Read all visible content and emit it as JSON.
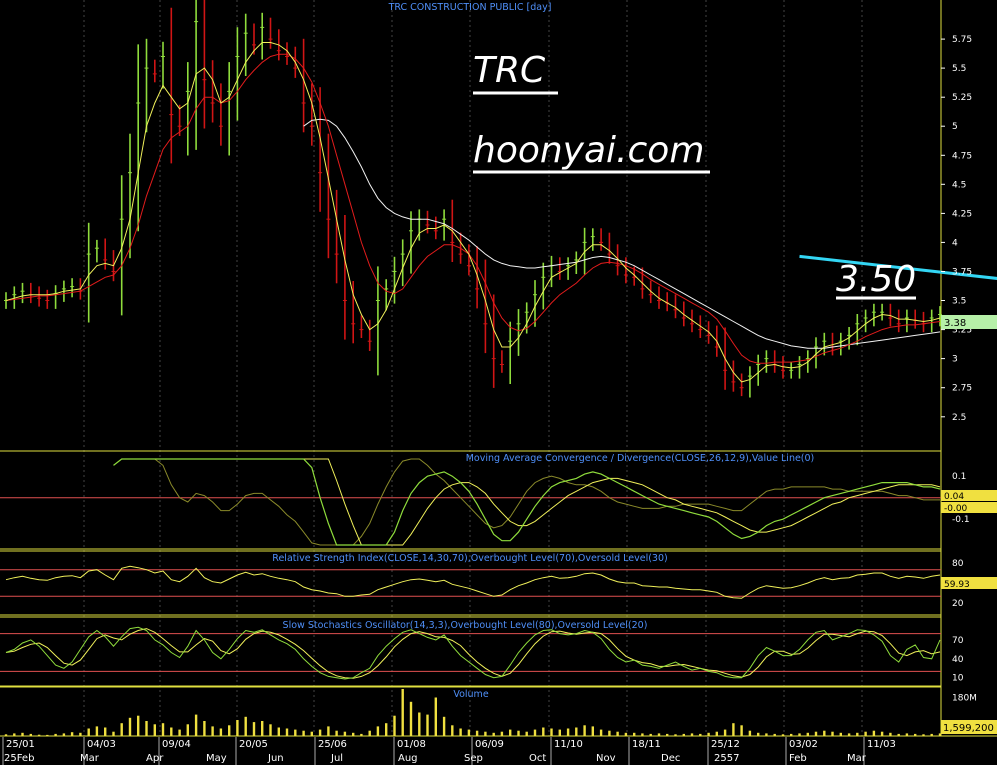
{
  "chart_data": {
    "type": "line",
    "title": "TRC CONSTRUCTION PUBLIC [day]",
    "annotations": {
      "ticker": "TRC",
      "website": "hoonyai.com",
      "price_target": "3.50"
    },
    "colors": {
      "background": "#000000",
      "candle_up": "#8fdc3c",
      "candle_down": "#d01515",
      "ma_fast": "#f0f05a",
      "ma_mid": "#e21c1c",
      "ma_slow": "#f2f2f2",
      "trendline": "#33d6f4",
      "panel_border": "#e0e040",
      "level_line": "#e05050",
      "header_text": "#4f8ff7",
      "volume": "#f0e040",
      "last_label_price": "#b6f0a8",
      "last_label_other": "#f0e040"
    },
    "price_panel": {
      "ylim": [
        2.3,
        6.0
      ],
      "y_ticks": [
        "5.75",
        "5.5",
        "5.25",
        "5",
        "4.75",
        "4.5",
        "4.25",
        "4",
        "3.75",
        "3.5",
        "3.25",
        "3",
        "2.75",
        "2.5"
      ],
      "last_value": "3.38",
      "trendline": {
        "from": [
          96,
          3.88
        ],
        "to": [
          159,
          3.38
        ]
      },
      "close": [
        3.5,
        3.55,
        3.58,
        3.55,
        3.52,
        3.5,
        3.56,
        3.6,
        3.62,
        3.58,
        3.9,
        3.95,
        3.85,
        3.75,
        4.2,
        4.6,
        5.2,
        5.5,
        5.45,
        5.6,
        5.1,
        5.0,
        5.3,
        5.9,
        5.4,
        5.2,
        5.0,
        5.3,
        5.6,
        5.8,
        5.7,
        5.85,
        5.75,
        5.65,
        5.6,
        5.5,
        5.2,
        5.0,
        4.6,
        4.2,
        3.9,
        3.5,
        3.3,
        3.25,
        3.15,
        3.5,
        3.6,
        3.75,
        3.9,
        4.1,
        4.2,
        4.15,
        4.1,
        4.2,
        4.0,
        3.9,
        3.8,
        3.6,
        3.3,
        3.0,
        2.95,
        3.15,
        3.3,
        3.4,
        3.55,
        3.7,
        3.8,
        3.75,
        3.8,
        3.85,
        4.0,
        4.05,
        4.0,
        3.9,
        3.8,
        3.72,
        3.7,
        3.6,
        3.55,
        3.5,
        3.48,
        3.42,
        3.35,
        3.3,
        3.25,
        3.2,
        3.1,
        2.9,
        2.8,
        2.75,
        2.85,
        2.95,
        3.0,
        2.95,
        2.9,
        2.9,
        2.95,
        3.0,
        3.1,
        3.15,
        3.1,
        3.15,
        3.2,
        3.3,
        3.35,
        3.4,
        3.4,
        3.35,
        3.3,
        3.35,
        3.33,
        3.3,
        3.35,
        3.38
      ],
      "ma_fast": [
        3.5,
        3.52,
        3.54,
        3.55,
        3.55,
        3.55,
        3.56,
        3.58,
        3.59,
        3.6,
        3.72,
        3.8,
        3.82,
        3.8,
        3.95,
        4.2,
        4.6,
        5.0,
        5.2,
        5.35,
        5.25,
        5.15,
        5.2,
        5.45,
        5.5,
        5.4,
        5.2,
        5.25,
        5.4,
        5.55,
        5.65,
        5.72,
        5.72,
        5.7,
        5.65,
        5.55,
        5.4,
        5.2,
        4.9,
        4.55,
        4.2,
        3.85,
        3.55,
        3.38,
        3.25,
        3.3,
        3.42,
        3.6,
        3.78,
        3.95,
        4.08,
        4.12,
        4.12,
        4.15,
        4.1,
        4.0,
        3.9,
        3.72,
        3.5,
        3.25,
        3.1,
        3.1,
        3.18,
        3.3,
        3.45,
        3.58,
        3.7,
        3.74,
        3.78,
        3.82,
        3.92,
        3.98,
        3.98,
        3.93,
        3.86,
        3.78,
        3.72,
        3.65,
        3.58,
        3.52,
        3.48,
        3.44,
        3.38,
        3.33,
        3.28,
        3.23,
        3.15,
        3.0,
        2.88,
        2.8,
        2.82,
        2.88,
        2.94,
        2.95,
        2.93,
        2.92,
        2.93,
        2.97,
        3.04,
        3.1,
        3.12,
        3.14,
        3.18,
        3.24,
        3.3,
        3.35,
        3.38,
        3.37,
        3.34,
        3.34,
        3.33,
        3.32,
        3.33,
        3.35
      ],
      "ma_mid": [
        3.5,
        3.51,
        3.52,
        3.53,
        3.54,
        3.54,
        3.55,
        3.56,
        3.57,
        3.58,
        3.62,
        3.66,
        3.7,
        3.72,
        3.8,
        3.95,
        4.15,
        4.4,
        4.6,
        4.8,
        4.9,
        4.95,
        5.0,
        5.15,
        5.25,
        5.25,
        5.2,
        5.22,
        5.3,
        5.4,
        5.48,
        5.55,
        5.6,
        5.62,
        5.62,
        5.58,
        5.5,
        5.38,
        5.2,
        5.0,
        4.75,
        4.5,
        4.25,
        4.0,
        3.8,
        3.65,
        3.58,
        3.56,
        3.6,
        3.7,
        3.8,
        3.88,
        3.93,
        3.98,
        3.98,
        3.95,
        3.9,
        3.8,
        3.65,
        3.48,
        3.35,
        3.27,
        3.24,
        3.26,
        3.32,
        3.4,
        3.48,
        3.55,
        3.6,
        3.65,
        3.72,
        3.78,
        3.82,
        3.83,
        3.82,
        3.8,
        3.77,
        3.73,
        3.68,
        3.64,
        3.6,
        3.56,
        3.52,
        3.48,
        3.44,
        3.4,
        3.34,
        3.24,
        3.13,
        3.03,
        2.98,
        2.96,
        2.96,
        2.97,
        2.97,
        2.97,
        2.98,
        2.99,
        3.02,
        3.05,
        3.07,
        3.09,
        3.12,
        3.15,
        3.19,
        3.22,
        3.25,
        3.27,
        3.28,
        3.29,
        3.29,
        3.3,
        3.31,
        3.32
      ],
      "ma_slow": [
        null,
        null,
        null,
        null,
        null,
        null,
        null,
        null,
        null,
        null,
        null,
        null,
        null,
        null,
        null,
        null,
        null,
        null,
        null,
        null,
        null,
        null,
        null,
        null,
        null,
        null,
        null,
        null,
        null,
        null,
        null,
        null,
        null,
        null,
        null,
        null,
        5.0,
        5.05,
        5.06,
        5.05,
        5.0,
        4.9,
        4.78,
        4.65,
        4.5,
        4.38,
        4.3,
        4.25,
        4.22,
        4.2,
        4.2,
        4.2,
        4.18,
        4.16,
        4.12,
        4.07,
        4.02,
        3.96,
        3.9,
        3.85,
        3.82,
        3.8,
        3.79,
        3.78,
        3.78,
        3.79,
        3.8,
        3.81,
        3.82,
        3.83,
        3.85,
        3.87,
        3.88,
        3.87,
        3.85,
        3.83,
        3.8,
        3.76,
        3.72,
        3.68,
        3.64,
        3.6,
        3.56,
        3.52,
        3.48,
        3.44,
        3.4,
        3.36,
        3.32,
        3.28,
        3.24,
        3.2,
        3.17,
        3.15,
        3.13,
        3.11,
        3.1,
        3.09,
        3.09,
        3.09,
        3.1,
        3.11,
        3.12,
        3.13,
        3.14,
        3.15,
        3.16,
        3.17,
        3.18,
        3.19,
        3.2,
        3.21,
        3.22,
        3.23
      ]
    },
    "macd_panel": {
      "label": "Moving Average Convergence / Divergence(CLOSE,26,12,9),Value Line(0)",
      "ylim": [
        -0.22,
        0.18
      ],
      "y_ticks": [
        "0.1",
        "-0.00",
        "-0.1"
      ],
      "zero_line": 0,
      "last_values": [
        "0.04",
        "-0.00"
      ],
      "macd": [
        null,
        null,
        null,
        null,
        null,
        null,
        null,
        null,
        null,
        null,
        null,
        null,
        null,
        0.15,
        0.24,
        0.36,
        0.5,
        0.62,
        0.66,
        0.68,
        0.63,
        0.58,
        0.56,
        0.6,
        0.6,
        0.56,
        0.5,
        0.48,
        0.5,
        0.54,
        0.56,
        0.56,
        0.53,
        0.48,
        0.42,
        0.35,
        0.25,
        0.14,
        0.0,
        -0.12,
        -0.22,
        -0.32,
        -0.38,
        -0.4,
        -0.4,
        -0.34,
        -0.26,
        -0.16,
        -0.06,
        0.02,
        0.07,
        0.1,
        0.11,
        0.12,
        0.1,
        0.07,
        0.03,
        -0.03,
        -0.1,
        -0.17,
        -0.2,
        -0.2,
        -0.16,
        -0.1,
        -0.04,
        0.01,
        0.05,
        0.07,
        0.08,
        0.09,
        0.11,
        0.12,
        0.11,
        0.09,
        0.07,
        0.05,
        0.03,
        0.01,
        -0.01,
        -0.03,
        -0.04,
        -0.05,
        -0.06,
        -0.07,
        -0.08,
        -0.09,
        -0.11,
        -0.14,
        -0.17,
        -0.19,
        -0.18,
        -0.16,
        -0.13,
        -0.11,
        -0.1,
        -0.08,
        -0.06,
        -0.04,
        -0.02,
        0.0,
        0.01,
        0.02,
        0.03,
        0.04,
        0.05,
        0.06,
        0.07,
        0.07,
        0.07,
        0.07,
        0.06,
        0.05,
        0.05,
        0.04
      ],
      "signal": [
        null,
        null,
        null,
        null,
        null,
        null,
        null,
        null,
        null,
        null,
        null,
        null,
        null,
        null,
        null,
        null,
        0.28,
        0.38,
        0.46,
        0.53,
        0.57,
        0.58,
        0.58,
        0.58,
        0.59,
        0.58,
        0.56,
        0.54,
        0.53,
        0.53,
        0.54,
        0.54,
        0.54,
        0.52,
        0.5,
        0.46,
        0.41,
        0.35,
        0.27,
        0.18,
        0.08,
        -0.03,
        -0.13,
        -0.22,
        -0.28,
        -0.31,
        -0.31,
        -0.28,
        -0.23,
        -0.17,
        -0.11,
        -0.05,
        0.0,
        0.04,
        0.06,
        0.07,
        0.07,
        0.05,
        0.02,
        -0.03,
        -0.07,
        -0.11,
        -0.13,
        -0.13,
        -0.11,
        -0.08,
        -0.05,
        -0.02,
        0.01,
        0.03,
        0.05,
        0.07,
        0.08,
        0.09,
        0.09,
        0.08,
        0.07,
        0.06,
        0.04,
        0.02,
        0.0,
        -0.01,
        -0.03,
        -0.04,
        -0.05,
        -0.06,
        -0.07,
        -0.09,
        -0.11,
        -0.13,
        -0.15,
        -0.16,
        -0.16,
        -0.15,
        -0.14,
        -0.13,
        -0.11,
        -0.09,
        -0.07,
        -0.05,
        -0.03,
        -0.02,
        0.0,
        0.01,
        0.02,
        0.03,
        0.04,
        0.05,
        0.06,
        0.06,
        0.06,
        0.06,
        0.06,
        0.05
      ],
      "histogram": [
        null,
        null,
        null,
        null,
        null,
        null,
        null,
        null,
        null,
        null,
        null,
        null,
        null,
        null,
        null,
        null,
        0.22,
        0.24,
        0.2,
        0.15,
        0.06,
        0.0,
        -0.02,
        0.02,
        0.01,
        -0.02,
        -0.06,
        -0.06,
        -0.03,
        0.01,
        0.02,
        0.02,
        -0.01,
        -0.04,
        -0.08,
        -0.11,
        -0.16,
        -0.21,
        -0.27,
        -0.3,
        -0.3,
        -0.29,
        -0.25,
        -0.18,
        -0.12,
        -0.03,
        0.05,
        0.12,
        0.17,
        0.19,
        0.18,
        0.15,
        0.11,
        0.08,
        0.04,
        0.0,
        -0.04,
        -0.08,
        -0.12,
        -0.14,
        -0.13,
        -0.09,
        -0.03,
        0.03,
        0.07,
        0.09,
        0.1,
        0.09,
        0.07,
        0.06,
        0.06,
        0.05,
        0.03,
        0.0,
        -0.02,
        -0.03,
        -0.04,
        -0.05,
        -0.05,
        -0.05,
        -0.04,
        -0.04,
        -0.03,
        -0.03,
        -0.03,
        -0.03,
        -0.04,
        -0.05,
        -0.06,
        -0.06,
        -0.03,
        0.0,
        0.03,
        0.04,
        0.04,
        0.05,
        0.05,
        0.05,
        0.05,
        0.05,
        0.04,
        0.04,
        0.03,
        0.03,
        0.03,
        0.03,
        0.03,
        0.02,
        0.01,
        0.01,
        0.0,
        -0.01,
        -0.01,
        -0.01
      ]
    },
    "rsi_panel": {
      "label": "Relative Strength Index(CLOSE,14,30,70),Overbought Level(70),Oversold Level(30)",
      "ylim": [
        5,
        95
      ],
      "y_ticks": [
        "80",
        "20"
      ],
      "overbought": 70,
      "oversold": 30,
      "last_value": "59.93",
      "rsi": [
        55,
        58,
        60,
        57,
        55,
        54,
        58,
        60,
        61,
        58,
        68,
        70,
        62,
        55,
        72,
        75,
        73,
        70,
        65,
        68,
        55,
        52,
        60,
        72,
        58,
        52,
        50,
        56,
        62,
        66,
        62,
        64,
        60,
        57,
        55,
        52,
        44,
        40,
        38,
        35,
        34,
        30,
        30,
        32,
        33,
        40,
        44,
        48,
        52,
        55,
        56,
        54,
        52,
        54,
        48,
        45,
        42,
        38,
        34,
        30,
        32,
        40,
        46,
        50,
        55,
        58,
        60,
        57,
        58,
        60,
        64,
        65,
        62,
        56,
        52,
        50,
        50,
        46,
        45,
        44,
        44,
        42,
        41,
        40,
        40,
        38,
        36,
        30,
        28,
        27,
        35,
        42,
        46,
        44,
        42,
        43,
        46,
        50,
        55,
        58,
        55,
        57,
        58,
        62,
        63,
        65,
        65,
        60,
        57,
        60,
        59,
        57,
        60,
        62
      ]
    },
    "stoch_panel": {
      "label": "Slow Stochastics Oscillator(14,3,3),Overbought Level(80),Oversold Level(20)",
      "ylim": [
        0,
        100
      ],
      "y_ticks": [
        "70",
        "40",
        "10"
      ],
      "overbought": 80,
      "oversold": 20,
      "k": [
        50,
        55,
        65,
        70,
        60,
        45,
        30,
        25,
        35,
        55,
        75,
        85,
        75,
        60,
        75,
        88,
        90,
        85,
        70,
        62,
        50,
        42,
        60,
        85,
        70,
        50,
        40,
        55,
        72,
        85,
        82,
        86,
        78,
        70,
        64,
        55,
        40,
        28,
        18,
        12,
        10,
        8,
        10,
        18,
        25,
        45,
        60,
        72,
        82,
        86,
        80,
        74,
        70,
        78,
        60,
        45,
        35,
        25,
        15,
        10,
        12,
        30,
        50,
        65,
        78,
        85,
        86,
        80,
        78,
        80,
        85,
        82,
        72,
        55,
        42,
        35,
        38,
        30,
        28,
        25,
        30,
        35,
        28,
        22,
        25,
        20,
        18,
        12,
        10,
        10,
        25,
        45,
        58,
        52,
        45,
        45,
        55,
        70,
        82,
        85,
        70,
        75,
        80,
        86,
        85,
        78,
        68,
        45,
        35,
        55,
        62,
        42,
        40,
        70
      ],
      "d": [
        50,
        52,
        58,
        63,
        65,
        58,
        45,
        33,
        30,
        38,
        55,
        72,
        78,
        73,
        70,
        79,
        85,
        88,
        82,
        72,
        61,
        51,
        51,
        62,
        72,
        68,
        53,
        48,
        56,
        71,
        80,
        84,
        82,
        78,
        71,
        63,
        53,
        41,
        29,
        19,
        13,
        10,
        9,
        12,
        18,
        29,
        43,
        59,
        71,
        80,
        83,
        80,
        75,
        74,
        69,
        61,
        47,
        35,
        25,
        17,
        12,
        17,
        31,
        48,
        64,
        76,
        83,
        84,
        81,
        79,
        81,
        82,
        80,
        70,
        56,
        44,
        38,
        34,
        32,
        28,
        28,
        30,
        31,
        28,
        25,
        22,
        21,
        17,
        13,
        11,
        15,
        27,
        43,
        52,
        52,
        47,
        48,
        57,
        69,
        79,
        79,
        77,
        75,
        80,
        84,
        83,
        77,
        64,
        49,
        45,
        51,
        53,
        48,
        51
      ]
    },
    "volume_panel": {
      "label": "Volume",
      "ylim": [
        0,
        220
      ],
      "y_ticks": [
        "180M"
      ],
      "last_value": "1,599,200",
      "units": "M",
      "volume": [
        8,
        12,
        15,
        10,
        6,
        5,
        10,
        12,
        18,
        15,
        35,
        45,
        40,
        20,
        60,
        85,
        95,
        70,
        55,
        60,
        40,
        30,
        55,
        100,
        70,
        45,
        35,
        50,
        75,
        90,
        65,
        70,
        55,
        40,
        35,
        30,
        25,
        20,
        30,
        45,
        25,
        20,
        15,
        10,
        25,
        45,
        60,
        95,
        220,
        160,
        110,
        100,
        180,
        90,
        50,
        35,
        30,
        25,
        20,
        15,
        20,
        30,
        25,
        20,
        30,
        40,
        35,
        30,
        35,
        40,
        50,
        45,
        30,
        25,
        20,
        15,
        15,
        12,
        10,
        12,
        10,
        8,
        10,
        12,
        10,
        15,
        20,
        30,
        60,
        50,
        25,
        15,
        12,
        10,
        8,
        10,
        12,
        15,
        20,
        25,
        20,
        15,
        12,
        15,
        20,
        25,
        20,
        15,
        10,
        12,
        10,
        8,
        10,
        12
      ]
    },
    "date_labels": [
      "25/01",
      "04/03",
      "09/04",
      "20/05",
      "25/06",
      "01/08",
      "06/09",
      "11/10",
      "18/11",
      "25/12",
      "03/02",
      "11/03"
    ],
    "month_labels": [
      "25Feb",
      "Mar",
      "Apr",
      "May",
      "Jun",
      "Jul",
      "Aug",
      "Sep",
      "Oct",
      "Nov",
      "Dec",
      "2557",
      "Feb",
      "Mar"
    ]
  }
}
